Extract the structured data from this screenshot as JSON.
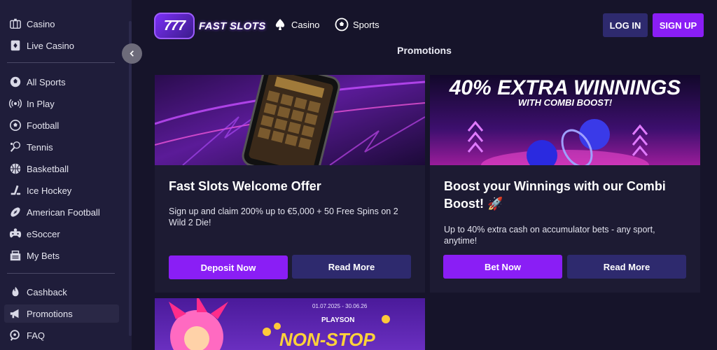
{
  "sidebar": {
    "top_items": [
      {
        "label": "Casino",
        "icon": "casino-icon"
      },
      {
        "label": "Live Casino",
        "icon": "live-casino-icon"
      }
    ],
    "sport_items": [
      {
        "label": "All Sports",
        "icon": "all-sports-icon"
      },
      {
        "label": "In Play",
        "icon": "in-play-icon"
      },
      {
        "label": "Football",
        "icon": "football-icon"
      },
      {
        "label": "Tennis",
        "icon": "tennis-icon"
      },
      {
        "label": "Basketball",
        "icon": "basketball-icon"
      },
      {
        "label": "Ice Hockey",
        "icon": "ice-hockey-icon"
      },
      {
        "label": "American Football",
        "icon": "american-football-icon"
      },
      {
        "label": "eSoccer",
        "icon": "esoccer-icon"
      },
      {
        "label": "My Bets",
        "icon": "my-bets-icon"
      }
    ],
    "bottom_items": [
      {
        "label": "Cashback",
        "icon": "cashback-icon"
      },
      {
        "label": "Promotions",
        "icon": "promotions-icon",
        "active": true
      },
      {
        "label": "FAQ",
        "icon": "faq-icon"
      }
    ]
  },
  "header": {
    "logo_number": "777",
    "logo_text": "FAST SLOTS",
    "nav": [
      {
        "label": "Casino",
        "icon": "spade-icon"
      },
      {
        "label": "Sports",
        "icon": "soccer-ball-icon"
      }
    ],
    "login_label": "LOG IN",
    "signup_label": "SIGN UP"
  },
  "page": {
    "title": "Promotions"
  },
  "promotions": [
    {
      "title": "Fast Slots Welcome Offer",
      "description": "Sign up and claim 200% up to €5,000 + 50 Free Spins on 2 Wild 2 Die!",
      "primary_label": "Deposit Now",
      "secondary_label": "Read More"
    },
    {
      "banner_heading": "40% EXTRA WINNINGS",
      "banner_subheading": "WITH COMBI BOOST!",
      "title": "Boost your Winnings with our Combi Boost! 🚀",
      "description": "Up to 40% extra cash on accumulator bets - any sport, anytime!",
      "primary_label": "Bet Now",
      "secondary_label": "Read More"
    },
    {
      "banner_dates": "01.07.2025 - 30.06.26",
      "banner_provider": "PLAYSON",
      "banner_heading": "NON-STOP"
    }
  ],
  "colors": {
    "accent": "#8a1ef5",
    "secondary": "#2e2a6e",
    "background": "#16142a",
    "card": "#1d1b33"
  }
}
